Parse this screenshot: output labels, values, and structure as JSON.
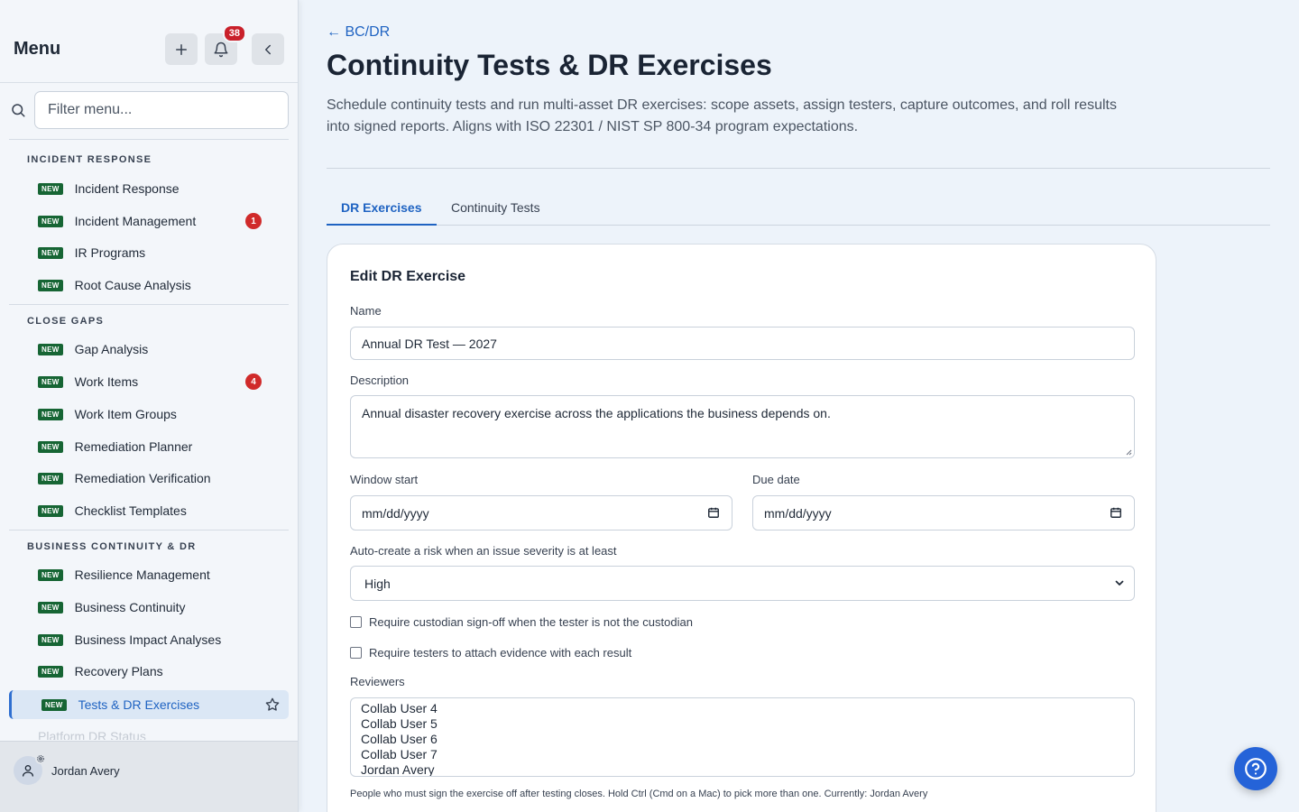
{
  "sidebar": {
    "title": "Menu",
    "notification_count": "38",
    "filter_placeholder": "Filter menu...",
    "new_label": "NEW",
    "sections": [
      {
        "title": "INCIDENT RESPONSE",
        "items": [
          {
            "label": "Incident Response"
          },
          {
            "label": "Incident Management",
            "count": "1"
          },
          {
            "label": "IR Programs"
          },
          {
            "label": "Root Cause Analysis"
          }
        ]
      },
      {
        "title": "CLOSE GAPS",
        "items": [
          {
            "label": "Gap Analysis"
          },
          {
            "label": "Work Items",
            "count": "4"
          },
          {
            "label": "Work Item Groups"
          },
          {
            "label": "Remediation Planner"
          },
          {
            "label": "Remediation Verification"
          },
          {
            "label": "Checklist Templates"
          }
        ]
      },
      {
        "title": "BUSINESS CONTINUITY & DR",
        "items": [
          {
            "label": "Resilience Management"
          },
          {
            "label": "Business Continuity"
          },
          {
            "label": "Business Impact Analyses"
          },
          {
            "label": "Recovery Plans"
          },
          {
            "label": "Tests & DR Exercises",
            "active": true
          },
          {
            "label": "Platform DR Status"
          }
        ]
      }
    ],
    "user": {
      "name": "Jordan Avery"
    }
  },
  "header": {
    "back_link": "← BC/DR",
    "title": "Continuity Tests & DR Exercises",
    "description": "Schedule continuity tests and run multi-asset DR exercises: scope assets, assign testers, capture outcomes, and roll results into signed reports. Aligns with ISO 22301 / NIST SP 800-34 program expectations."
  },
  "tabs": [
    {
      "label": "DR Exercises",
      "active": true
    },
    {
      "label": "Continuity Tests"
    }
  ],
  "form": {
    "title": "Edit DR Exercise",
    "name_label": "Name",
    "name_value": "Annual DR Test — 2027",
    "description_label": "Description",
    "description_value": "Annual disaster recovery exercise across the applications the business depends on.",
    "window_start_label": "Window start",
    "window_start_value": "mm/dd/yyyy",
    "due_date_label": "Due date",
    "due_date_value": "mm/dd/yyyy",
    "severity_label": "Auto-create a risk when an issue severity is at least",
    "severity_value": "High",
    "check_custodian": "Require custodian sign-off when the tester is not the custodian",
    "check_evidence": "Require testers to attach evidence with each result",
    "reviewers_label": "Reviewers",
    "reviewers": [
      "Collab User 4",
      "Collab User 5",
      "Collab User 6",
      "Collab User 7",
      "Jordan Avery"
    ],
    "reviewers_hint": "People who must sign the exercise off after testing closes. Hold Ctrl (Cmd on a Mac) to pick more than one. Currently: Jordan Avery"
  },
  "colors": {
    "accent": "#1f63c2",
    "new_badge": "#166534",
    "count_badge": "#d02a2a",
    "help_button": "#2563d8"
  }
}
